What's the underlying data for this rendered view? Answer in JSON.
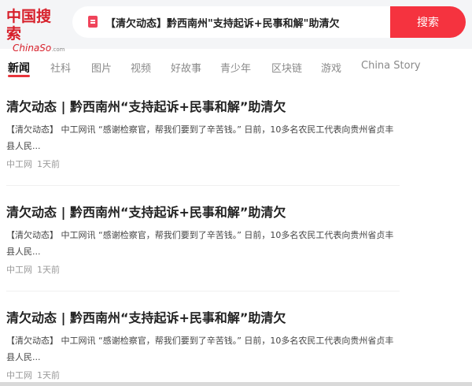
{
  "logo": {
    "text_cn": "中国搜索",
    "text_en": "ChinaSo",
    "text_en_suffix": ".com"
  },
  "search": {
    "value": "【清欠动态】黔西南州\"支持起诉+民事和解\"助清欠",
    "button_label": "搜索",
    "icon": "document-icon"
  },
  "tabs": [
    {
      "label": "新闻",
      "active": true
    },
    {
      "label": "社科",
      "active": false
    },
    {
      "label": "图片",
      "active": false
    },
    {
      "label": "视频",
      "active": false
    },
    {
      "label": "好故事",
      "active": false
    },
    {
      "label": "青少年",
      "active": false
    },
    {
      "label": "区块链",
      "active": false
    },
    {
      "label": "游戏",
      "active": false
    },
    {
      "label": "China Story",
      "active": false
    }
  ],
  "results": [
    {
      "title": "清欠动态 | 黔西南州“支持起诉+民事和解”助清欠",
      "snippet": "【清欠动态】 中工网讯 “感谢检察官，帮我们要到了辛苦钱。” 日前，10多名农民工代表向贵州省贞丰县人民...",
      "source": "中工网",
      "time": "1天前"
    },
    {
      "title": "清欠动态 | 黔西南州“支持起诉+民事和解”助清欠",
      "snippet": "【清欠动态】 中工网讯 “感谢检察官，帮我们要到了辛苦钱。” 日前，10多名农民工代表向贵州省贞丰县人民...",
      "source": "中工网",
      "time": "1天前"
    },
    {
      "title": "清欠动态 | 黔西南州“支持起诉+民事和解”助清欠",
      "snippet": "【清欠动态】 中工网讯 “感谢检察官，帮我们要到了辛苦钱。” 日前，10多名农民工代表向贵州省贞丰县人民...",
      "source": "中工网",
      "time": "1天前"
    }
  ],
  "colors": {
    "brand": "#d7202b",
    "button": "#f5333f",
    "tab_active_underline": "#e8353b"
  }
}
